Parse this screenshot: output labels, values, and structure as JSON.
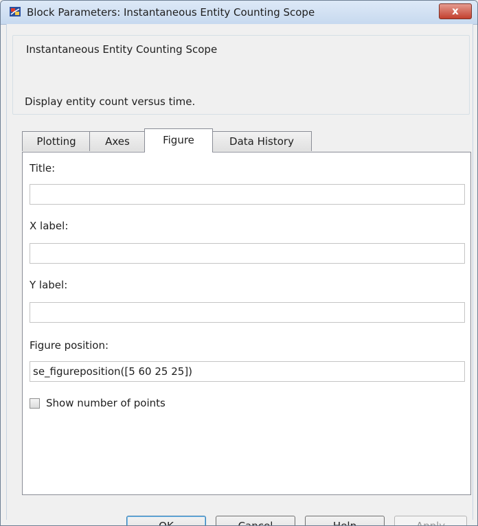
{
  "window": {
    "title": "Block Parameters: Instantaneous Entity Counting Scope",
    "close_label": "x"
  },
  "group": {
    "title": "Instantaneous Entity Counting Scope",
    "description": "Display entity count versus time."
  },
  "tabs": [
    {
      "label": "Plotting",
      "active": false
    },
    {
      "label": "Axes",
      "active": false
    },
    {
      "label": "Figure",
      "active": true
    },
    {
      "label": "Data History",
      "active": false
    }
  ],
  "figure": {
    "title_label": "Title:",
    "title_value": "",
    "xlabel_label": "X label:",
    "xlabel_value": "",
    "ylabel_label": "Y label:",
    "ylabel_value": "",
    "position_label": "Figure position:",
    "position_value": "se_figureposition([5 60 25 25])",
    "show_points_label": "Show number of points",
    "show_points_checked": false
  },
  "buttons": {
    "ok": "OK",
    "cancel": "Cancel",
    "help": "Help",
    "apply": "Apply"
  },
  "colors": {
    "close_button": "#c3402f",
    "focus_border": "#3c7fb1"
  }
}
